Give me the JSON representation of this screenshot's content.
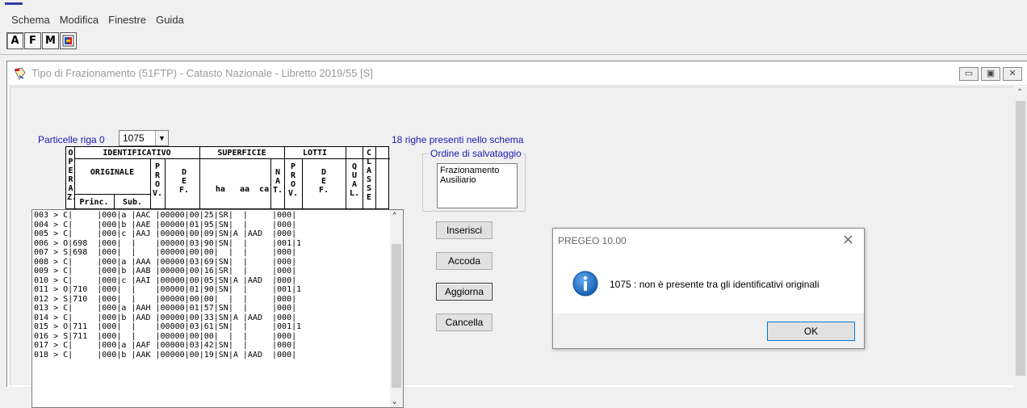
{
  "menu": [
    "Schema",
    "Modifica",
    "Finestre",
    "Guida"
  ],
  "toolbar": {
    "a": "A",
    "f": "F",
    "m": "M"
  },
  "child": {
    "title": "Tipo di Frazionamento (51FTP) - Catasto Nazionale - Libretto 2019/55 [S]",
    "buttons": {
      "min": "▭",
      "restore": "▣",
      "close": "✕"
    }
  },
  "particelle": {
    "label": "Particelle riga 0",
    "value": "1075"
  },
  "righe_label": "18 righe presenti nello schema",
  "grid_header": {
    "operaz": "O P E R A Z.",
    "identificativo": "IDENTIFICATIVO",
    "originale": "ORIGINALE",
    "princ": "Princ.",
    "sub": "Sub.",
    "prov": "P R O V.",
    "def": "D E F.",
    "superficie": "SUPERFICIE",
    "ha_aa_ca": "ha   aa  ca",
    "nat": "N A T.",
    "lotti": "LOTTI",
    "lotti_prov": "P R O V.",
    "lotti_def": "D E F.",
    "qual": "Q U A L.",
    "classe": "C L A S S E"
  },
  "rows": [
    "003 > C|     |000|a |AAC |00000|00|25|SR|  |     |000|",
    "004 > C|     |000|b |AAE |00000|01|95|SN|  |     |000|",
    "005 > C|     |000|c |AAJ |00000|00|09|SN|A |AAD  |000|",
    "006 > O|698  |000|  |    |00000|03|90|SN|  |     |001|1",
    "007 > S|698  |000|  |    |00000|00|00|  |  |     |000|",
    "008 > C|     |000|a |AAA |00000|03|69|SN|  |     |000|",
    "009 > C|     |000|b |AAB |00000|00|16|SR|  |     |000|",
    "010 > C|     |000|c |AAI |00000|00|05|SN|A |AAD  |000|",
    "011 > O|710  |000|  |    |00000|01|90|SN|  |     |001|1",
    "012 > S|710  |000|  |    |00000|00|00|  |  |     |000|",
    "013 > C|     |000|a |AAH |00000|01|57|SN|  |     |000|",
    "014 > C|     |000|b |AAD |00000|00|33|SN|A |AAD  |000|",
    "015 > O|711  |000|  |    |00000|03|61|SN|  |     |001|1",
    "016 > S|711  |000|  |    |00000|00|00|  |  |     |000|",
    "017 > C|     |000|a |AAF |00000|03|42|SN|  |     |000|",
    "018 > C|     |000|b |AAK |00000|00|19|SN|A |AAD  |000|"
  ],
  "ordine": {
    "label": "Ordine di salvataggio",
    "items": [
      "Frazionamento",
      "Ausiliario"
    ]
  },
  "buttons": {
    "inserisci": "Inserisci",
    "accoda": "Accoda",
    "aggiorna": "Aggiorna",
    "cancella": "Cancella"
  },
  "dialog": {
    "title": "PREGEO 10.00",
    "message": "1075 : non è presente tra gli identificativi originali",
    "ok": "OK"
  }
}
